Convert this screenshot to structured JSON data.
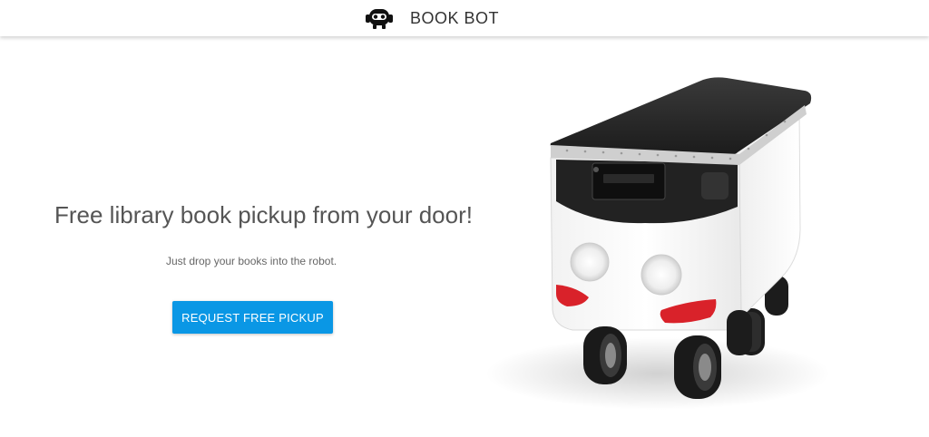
{
  "header": {
    "brand_name": "BOOK BOT",
    "logo_icon": "robot-logo-icon"
  },
  "hero": {
    "headline": "Free library book pickup from your door!",
    "subtext": "Just drop your books into the robot.",
    "cta_label": "REQUEST FREE PICKUP",
    "image": "delivery-robot-image"
  },
  "colors": {
    "accent": "#0a97e5",
    "header_bg": "#ffffff",
    "headline_text": "#555555",
    "robot_light": "#d9222a"
  }
}
